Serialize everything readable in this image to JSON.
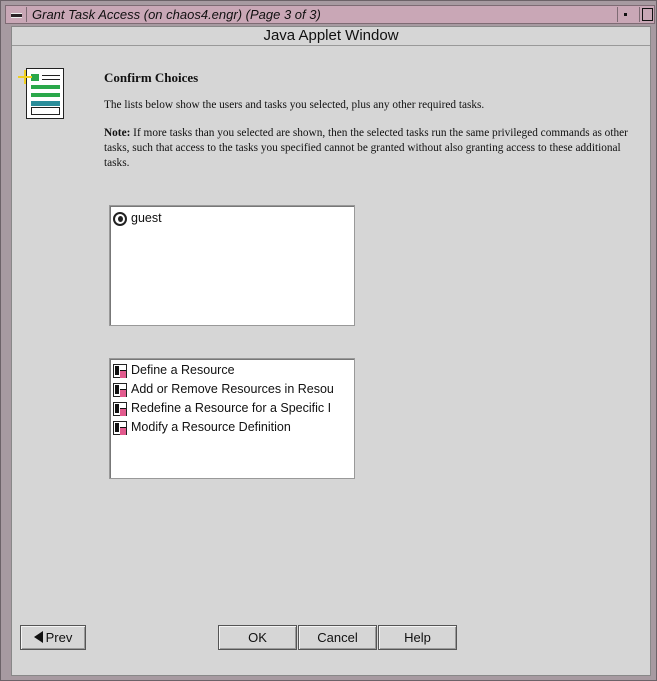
{
  "window": {
    "title": "Grant Task Access (on chaos4.engr) (Page 3 of 3)"
  },
  "applet": {
    "header": "Java Applet Window"
  },
  "content": {
    "heading": "Confirm Choices",
    "intro": "The lists below show the users and tasks you selected, plus any other required tasks.",
    "note_label": "Note:",
    "note_text": " If more tasks than you selected are shown, then the selected tasks run the same privileged commands as other tasks, such that access to the tasks you specified cannot be granted without also granting access to these additional tasks."
  },
  "users": [
    {
      "label": "guest",
      "icon": "user-icon"
    }
  ],
  "tasks": [
    {
      "label": "Define a Resource",
      "icon": "task-icon"
    },
    {
      "label": "Add or Remove Resources in Resou",
      "icon": "task-icon"
    },
    {
      "label": "Redefine a Resource for a Specific I",
      "icon": "task-icon"
    },
    {
      "label": "Modify a Resource Definition",
      "icon": "task-icon"
    }
  ],
  "buttons": {
    "prev": "Prev",
    "ok": "OK",
    "cancel": "Cancel",
    "help": "Help"
  }
}
